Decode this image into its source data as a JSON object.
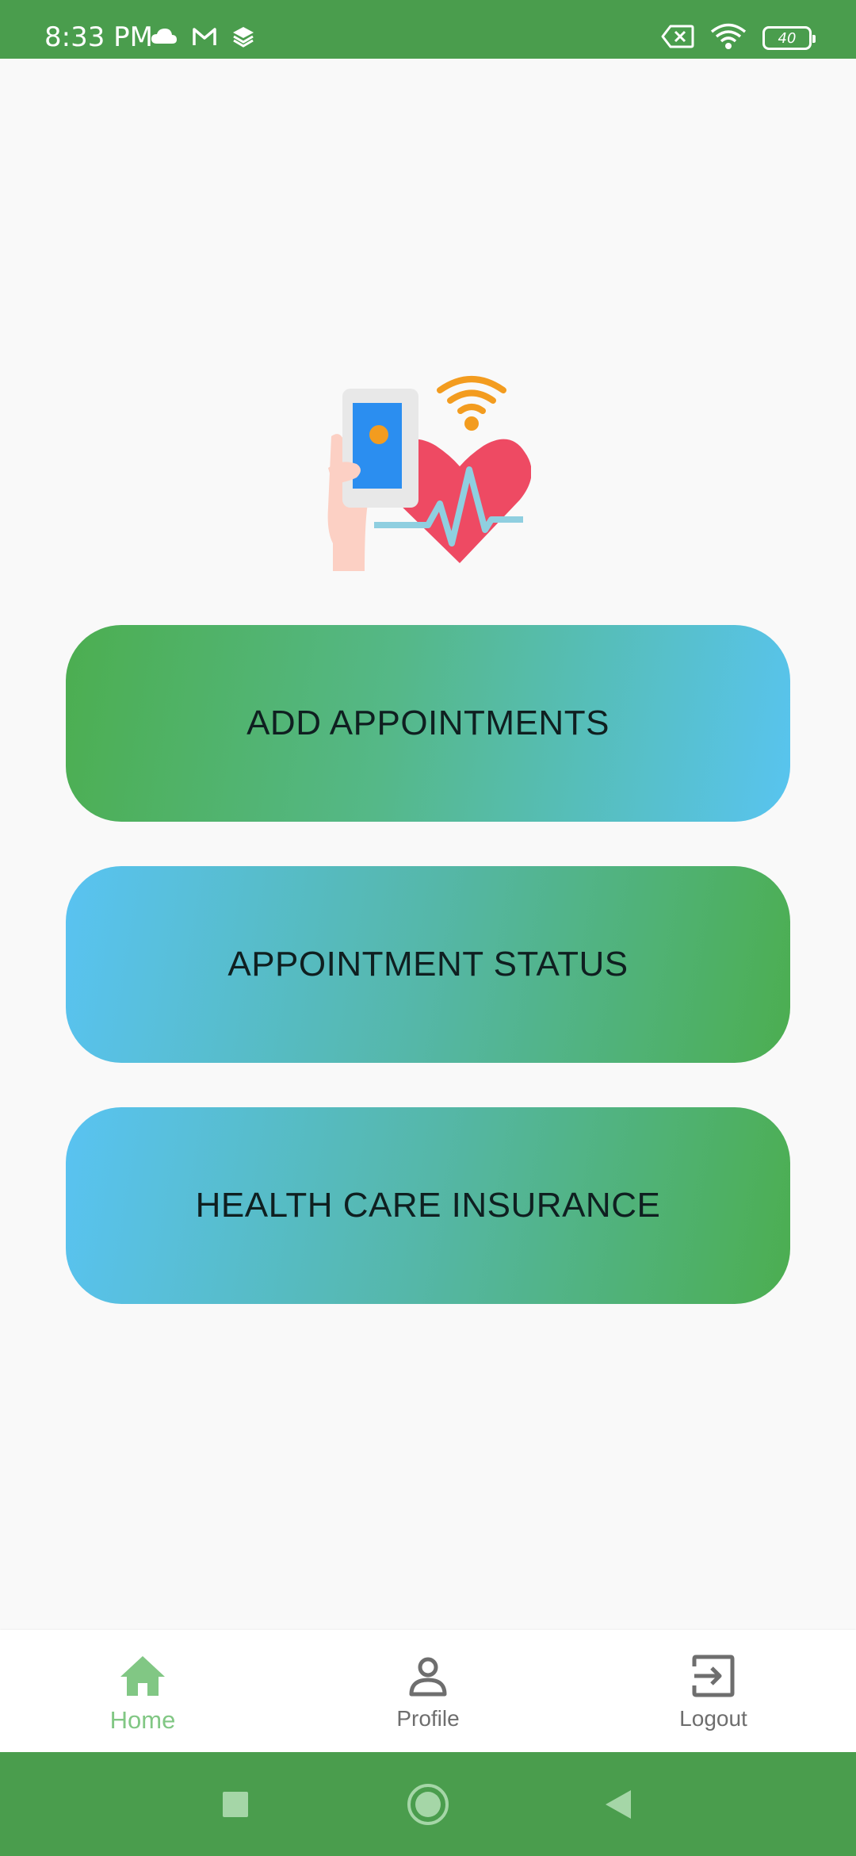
{
  "status_bar": {
    "time": "8:33 PM",
    "battery": "40",
    "left_icons": [
      "cloud-icon",
      "gmail-icon",
      "layers-icon"
    ],
    "right_icons": [
      "sim-error-icon",
      "wifi-icon",
      "battery-icon"
    ]
  },
  "hero": {
    "icon": "health-phone-heart-icon"
  },
  "buttons": [
    {
      "label": "ADD APPOINTMENTS"
    },
    {
      "label": "APPOINTMENT STATUS"
    },
    {
      "label": "HEALTH CARE INSURANCE"
    }
  ],
  "bottom_nav": {
    "items": [
      {
        "label": "Home",
        "icon": "home-icon",
        "active": true
      },
      {
        "label": "Profile",
        "icon": "person-icon",
        "active": false
      },
      {
        "label": "Logout",
        "icon": "logout-icon",
        "active": false
      }
    ]
  },
  "system_nav": {
    "buttons": [
      "recents-icon",
      "home-circle-icon",
      "back-icon"
    ]
  },
  "colors": {
    "status_bar": "#4a9d4d",
    "background": "#f9f9f9",
    "green": "#4cae50",
    "blue": "#59c3f2",
    "active_nav": "#81c784",
    "inactive_nav": "#6e6e6e"
  }
}
